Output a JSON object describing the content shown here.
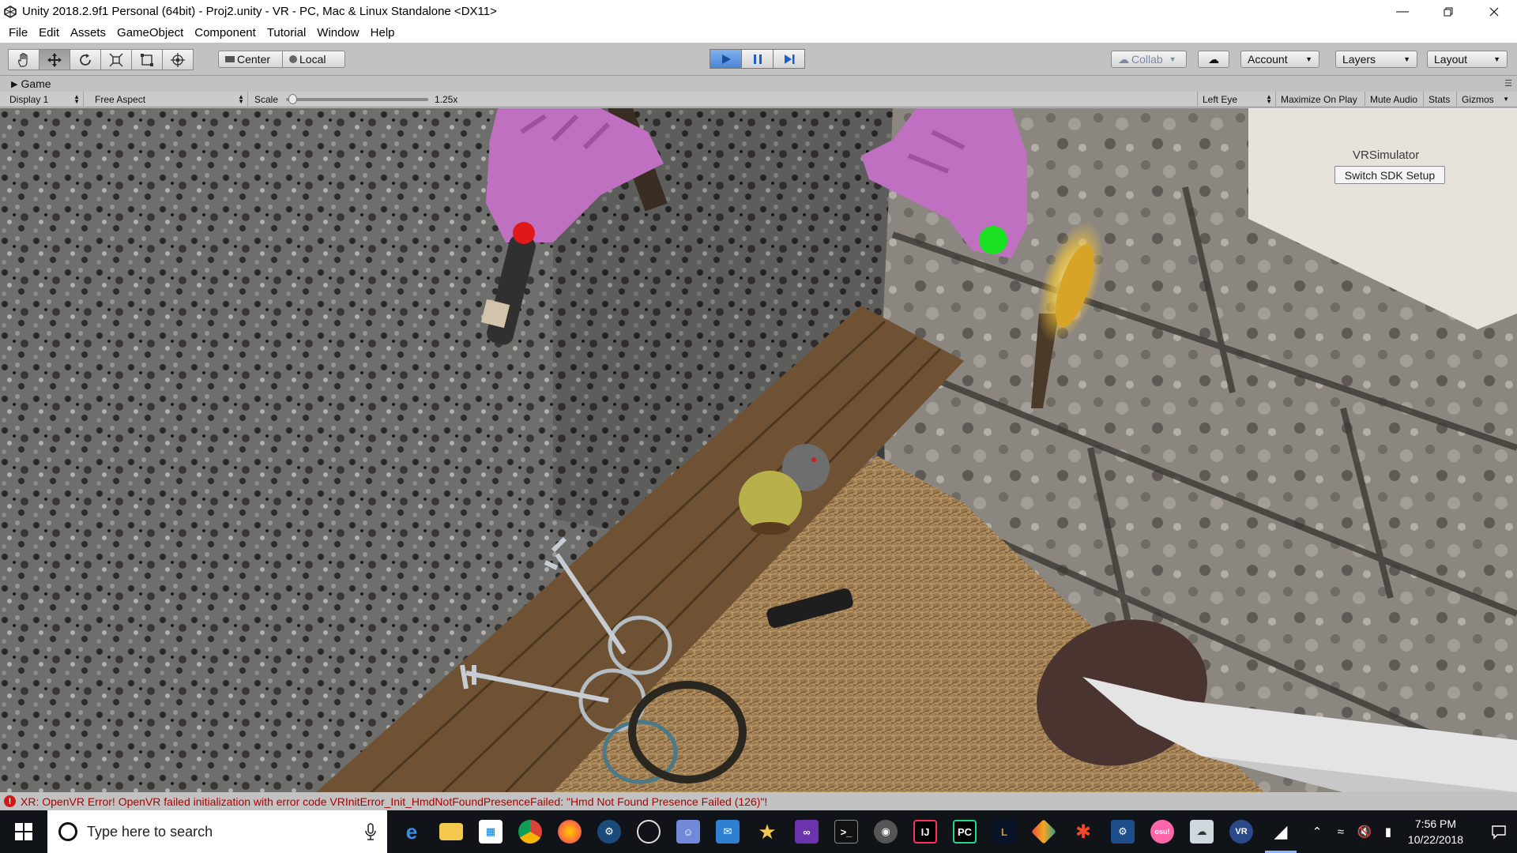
{
  "window": {
    "title": "Unity 2018.2.9f1 Personal (64bit) - Proj2.unity - VR - PC, Mac & Linux Standalone <DX11>",
    "controls": [
      "minimize",
      "restore",
      "close"
    ]
  },
  "menu": {
    "items": [
      "File",
      "Edit",
      "Assets",
      "GameObject",
      "Component",
      "Tutorial",
      "Window",
      "Help"
    ]
  },
  "toolbar": {
    "tools": [
      "hand-icon",
      "move-icon",
      "rotate-icon",
      "scale-icon",
      "rect-icon",
      "transform-icon"
    ],
    "pivot_label": "Center",
    "space_label": "Local",
    "collab_label": "Collab",
    "account_label": "Account",
    "layers_label": "Layers",
    "layout_label": "Layout",
    "play_state": "playing"
  },
  "game_view": {
    "tab_label": "Game",
    "display": "Display 1",
    "aspect": "Free Aspect",
    "scale_label": "Scale",
    "scale_value": "1.25x",
    "scale_fraction": 0.02,
    "eye": "Left Eye",
    "maximize_label": "Maximize On Play",
    "mute_label": "Mute Audio",
    "stats_label": "Stats",
    "gizmos_label": "Gizmos",
    "overlay": {
      "simulator_label": "VRSimulator",
      "sdk_button": "Switch SDK Setup"
    }
  },
  "status": {
    "message": "XR: OpenVR Error! OpenVR failed initialization with error code VRInitError_Init_HmdNotFoundPresenceFailed: \"Hmd Not Found Presence Failed (126)\"!"
  },
  "taskbar": {
    "search_placeholder": "Type here to search",
    "apps": [
      "edge",
      "file-explorer",
      "store",
      "chrome",
      "firefox",
      "steam",
      "unity-hub",
      "discord",
      "outlook",
      "star-app",
      "visual-studio",
      "terminal",
      "mumble",
      "intellij",
      "pycharm",
      "league",
      "git",
      "adobe",
      "teams",
      "osu",
      "cloud-app",
      "vr-app",
      "unity"
    ],
    "time": "7:56 PM",
    "date": "10/22/2018"
  },
  "colors": {
    "editor_bg": "#c2c2c2",
    "play_active": "#4b86d4",
    "error_red": "#b00000",
    "hand_color": "#c070c0",
    "left_controller": "#e01818",
    "right_controller": "#19e020"
  }
}
